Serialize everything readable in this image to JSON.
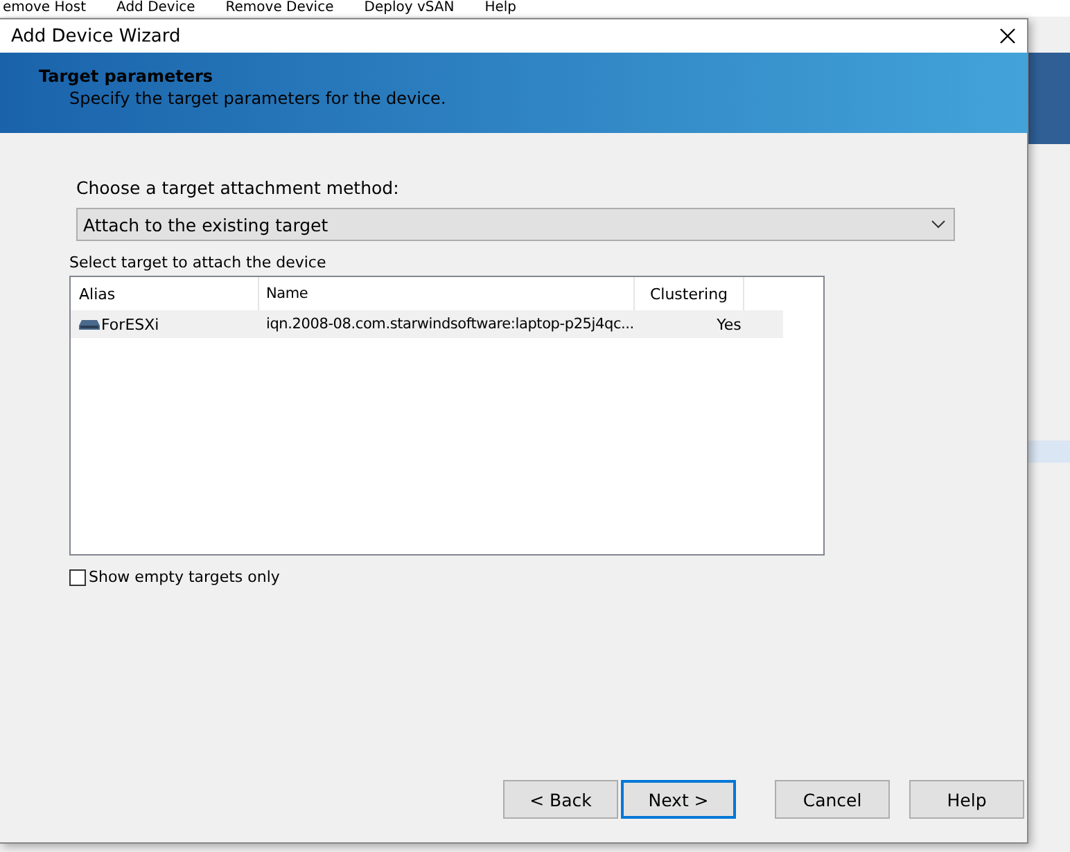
{
  "background_app": {
    "menu": [
      "emove Host",
      "Add Device",
      "Remove Device",
      "Deploy vSAN",
      "Help"
    ]
  },
  "window": {
    "title": "Add Device Wizard"
  },
  "banner": {
    "title": "Target parameters",
    "subtitle": "Specify the target parameters for the device."
  },
  "method": {
    "label": "Choose a target attachment method:",
    "value": "Attach to the existing target"
  },
  "targets": {
    "label": "Select target to attach the device",
    "columns": [
      "Alias",
      "Name",
      "Clustering"
    ],
    "rows": [
      {
        "alias": "ForESXi",
        "name": "iqn.2008-08.com.starwindsoftware:laptop-p25j4qc...",
        "clustering": "Yes",
        "selected": true
      }
    ]
  },
  "show_empty": {
    "label": "Show empty targets only",
    "checked": false
  },
  "buttons": [
    {
      "label": "< Back",
      "default": false
    },
    {
      "label": "Next >",
      "default": true
    },
    {
      "label": "Cancel",
      "default": false
    },
    {
      "label": "Help",
      "default": false
    }
  ]
}
